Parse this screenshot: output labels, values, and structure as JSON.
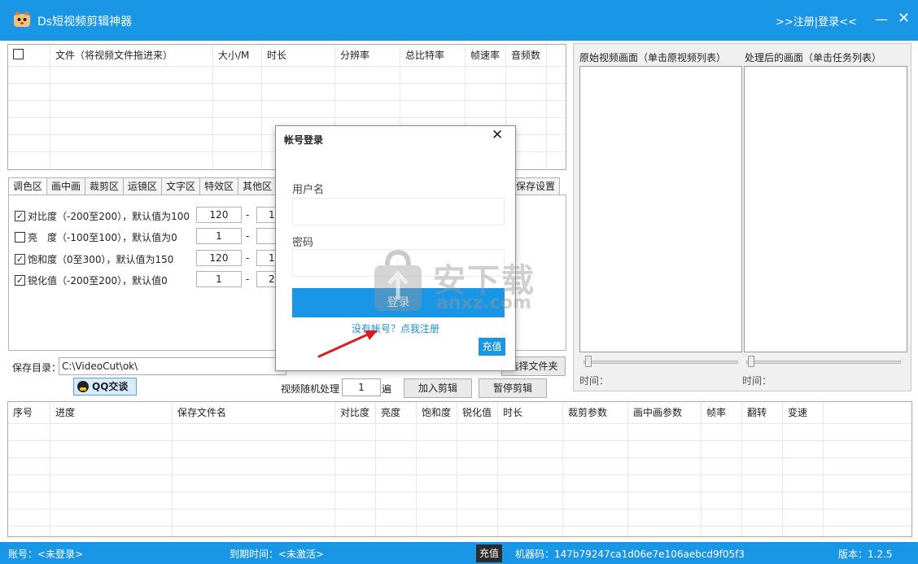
{
  "app": {
    "title": "Ds短视频剪辑神器",
    "login_link": ">>注册|登录<<",
    "minimize": "—",
    "close": "✕"
  },
  "file_table": {
    "columns": [
      "文件（将视频文件拖进来）",
      "大小/M",
      "时长",
      "分辨率",
      "总比特率",
      "帧速率",
      "音频数"
    ]
  },
  "preview": {
    "original_label": "原始视频画面（单击原视频列表）",
    "processed_label": "处理后的画面（单击任务列表）",
    "time_label": "时间："
  },
  "tabs": [
    "调色区",
    "画中画",
    "裁剪区",
    "运镜区",
    "文字区",
    "特效区",
    "其他区"
  ],
  "save_settings_tab": "保存设置",
  "color_settings": [
    {
      "checked": true,
      "label": "对比度（-200至200），默认值为100",
      "min": "120",
      "max": "1"
    },
    {
      "checked": false,
      "label": "亮　度（-100至100），默认值为0",
      "min": "1",
      "max": ""
    },
    {
      "checked": true,
      "label": "饱和度（0至300），默认值为150",
      "min": "120",
      "max": "1"
    },
    {
      "checked": true,
      "label": "锐化值（-200至200），默认值0",
      "min": "1",
      "max": "2"
    }
  ],
  "range_dash": "-",
  "save_dir": {
    "label": "保存目录：",
    "value": "C:\\VideoCut\\ok\\",
    "choose_button": "选择文件夹"
  },
  "qq_button": "QQ交谈",
  "random": {
    "label": "视频随机处理",
    "value": "1",
    "unit": "遍"
  },
  "add_button": "加入剪辑",
  "pause_button": "暂停剪辑",
  "task_table": {
    "columns": [
      "序号",
      "进度",
      "保存文件名",
      "对比度",
      "亮度",
      "饱和度",
      "锐化值",
      "时长",
      "裁剪参数",
      "画中画参数",
      "帧率",
      "翻转",
      "变速"
    ]
  },
  "status": {
    "account": "账号：<未登录>",
    "expire": "到期时间：<未激活>",
    "recharge": "充值",
    "machine": "机器码：147b79247ca1d06e7e106aebcd9f05f3",
    "version": "版本：1.2.5"
  },
  "dialog": {
    "title": "帐号登录",
    "close": "✕",
    "username_label": "用户名",
    "password_label": "密码",
    "login_button": "登录",
    "register_link": "没有帐号？点我注册",
    "recharge_button": "充值"
  },
  "watermark": {
    "text": "安下载",
    "sub": "anxz.com"
  },
  "colors": {
    "brand": "#1a96e6",
    "arrow": "#d42020"
  }
}
